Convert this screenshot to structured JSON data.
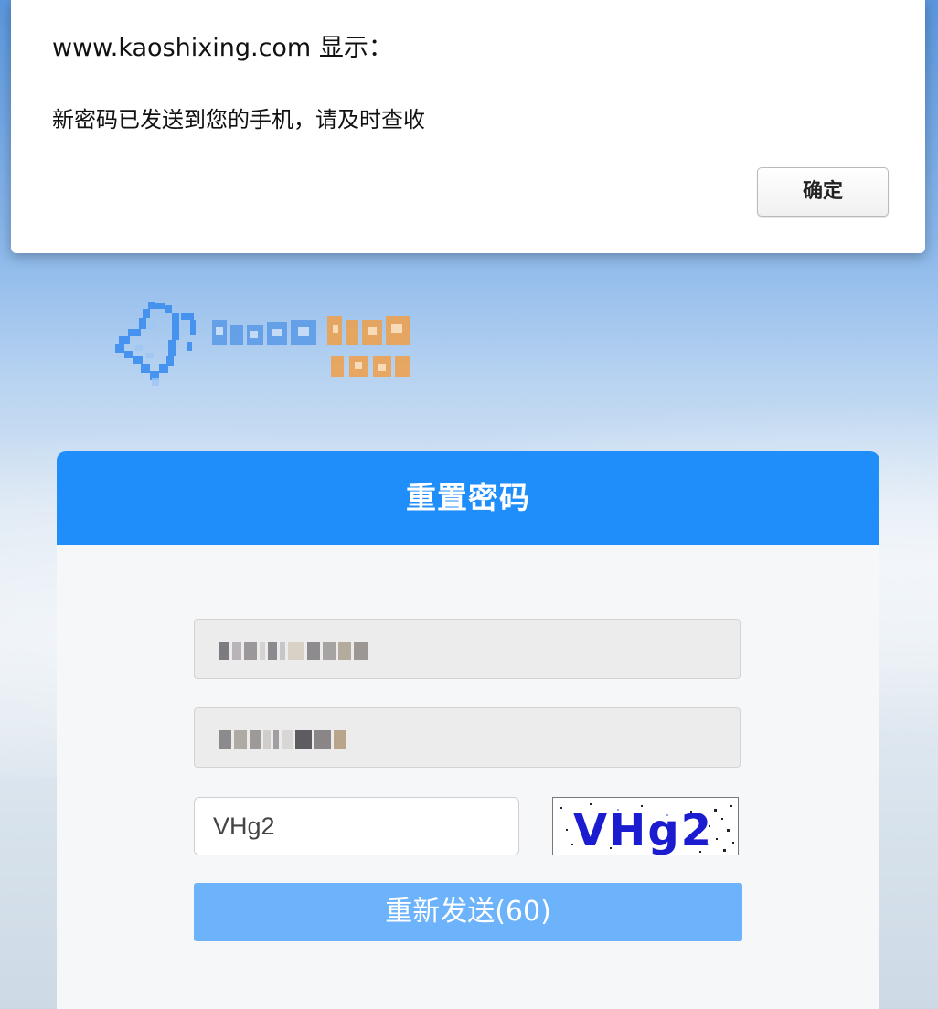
{
  "dialog": {
    "title": "www.kaoshixing.com 显示：",
    "message": "新密码已发送到您的手机，请及时查收",
    "ok_label": "确定"
  },
  "logo": {
    "name": "exam star",
    "colors": {
      "star": "#2a7de6",
      "text_primary": "#2a7de6",
      "text_accent": "#ef9a3a"
    }
  },
  "form": {
    "title": "重置密码",
    "captcha_value": "VHg2",
    "captcha_image_text": "VHg2",
    "resend_label": "重新发送(60)"
  },
  "colors": {
    "header": "#1f8efb",
    "button": "#6cb3fb",
    "captcha_text": "#1b1bd0"
  }
}
